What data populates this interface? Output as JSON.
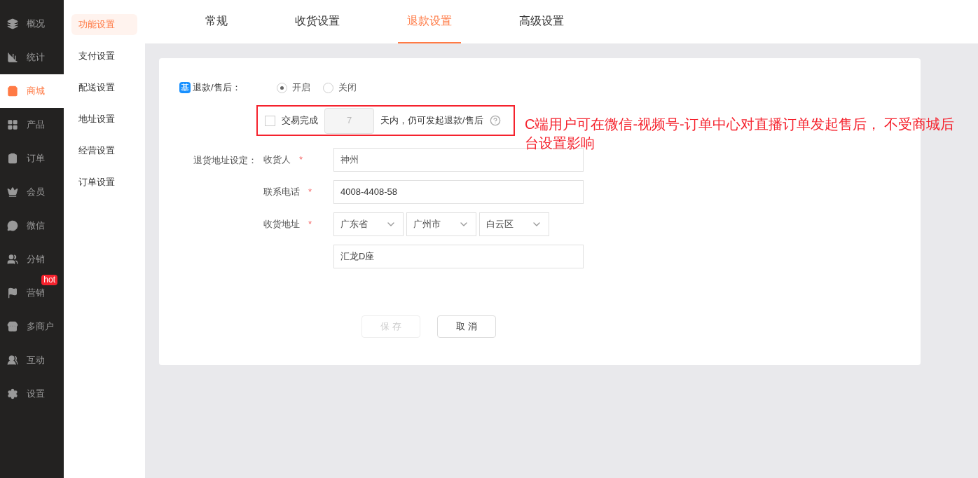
{
  "nav": [
    {
      "label": "概况",
      "selected": false
    },
    {
      "label": "统计",
      "selected": false
    },
    {
      "label": "商城",
      "selected": true
    },
    {
      "label": "产品",
      "selected": false
    },
    {
      "label": "订单",
      "selected": false
    },
    {
      "label": "会员",
      "selected": false
    },
    {
      "label": "微信",
      "selected": false
    },
    {
      "label": "分销",
      "selected": false
    },
    {
      "label": "营销",
      "selected": false,
      "badge": "hot"
    },
    {
      "label": "多商户",
      "selected": false
    },
    {
      "label": "互动",
      "selected": false
    },
    {
      "label": "设置",
      "selected": false
    }
  ],
  "subnav": [
    {
      "label": "功能设置",
      "selected": true
    },
    {
      "label": "支付设置",
      "selected": false
    },
    {
      "label": "配送设置",
      "selected": false
    },
    {
      "label": "地址设置",
      "selected": false
    },
    {
      "label": "经营设置",
      "selected": false
    },
    {
      "label": "订单设置",
      "selected": false
    }
  ],
  "tabs": [
    {
      "label": "常规",
      "selected": false
    },
    {
      "label": "收货设置",
      "selected": false
    },
    {
      "label": "退款设置",
      "selected": true
    },
    {
      "label": "高级设置",
      "selected": false
    }
  ],
  "form": {
    "refund": {
      "tag": "基",
      "label": "退款/售后：",
      "options": [
        {
          "label": "开启",
          "selected": true
        },
        {
          "label": "关闭",
          "selected": false
        }
      ]
    },
    "window": {
      "checked": false,
      "prefix": "交易完成",
      "days": "7",
      "suffix": "天内，仍可发起退款/售后"
    },
    "address_title": "退货地址设定：",
    "receiver": {
      "label": "收货人",
      "required": "*",
      "value": "神州"
    },
    "phone": {
      "label": "联系电话",
      "required": "*",
      "value": "4008-4408-58"
    },
    "region": {
      "label": "收货地址",
      "required": "*",
      "selects": [
        "广东省",
        "广州市",
        "白云区"
      ]
    },
    "street": {
      "value": "汇龙D座"
    },
    "buttons": [
      {
        "label": "保 存",
        "disabled": true
      },
      {
        "label": "取 消",
        "disabled": false
      }
    ]
  },
  "annotation": "C端用户可在微信-视频号-订单中心对直播订单发起售后， 不受商城后台设置影响"
}
